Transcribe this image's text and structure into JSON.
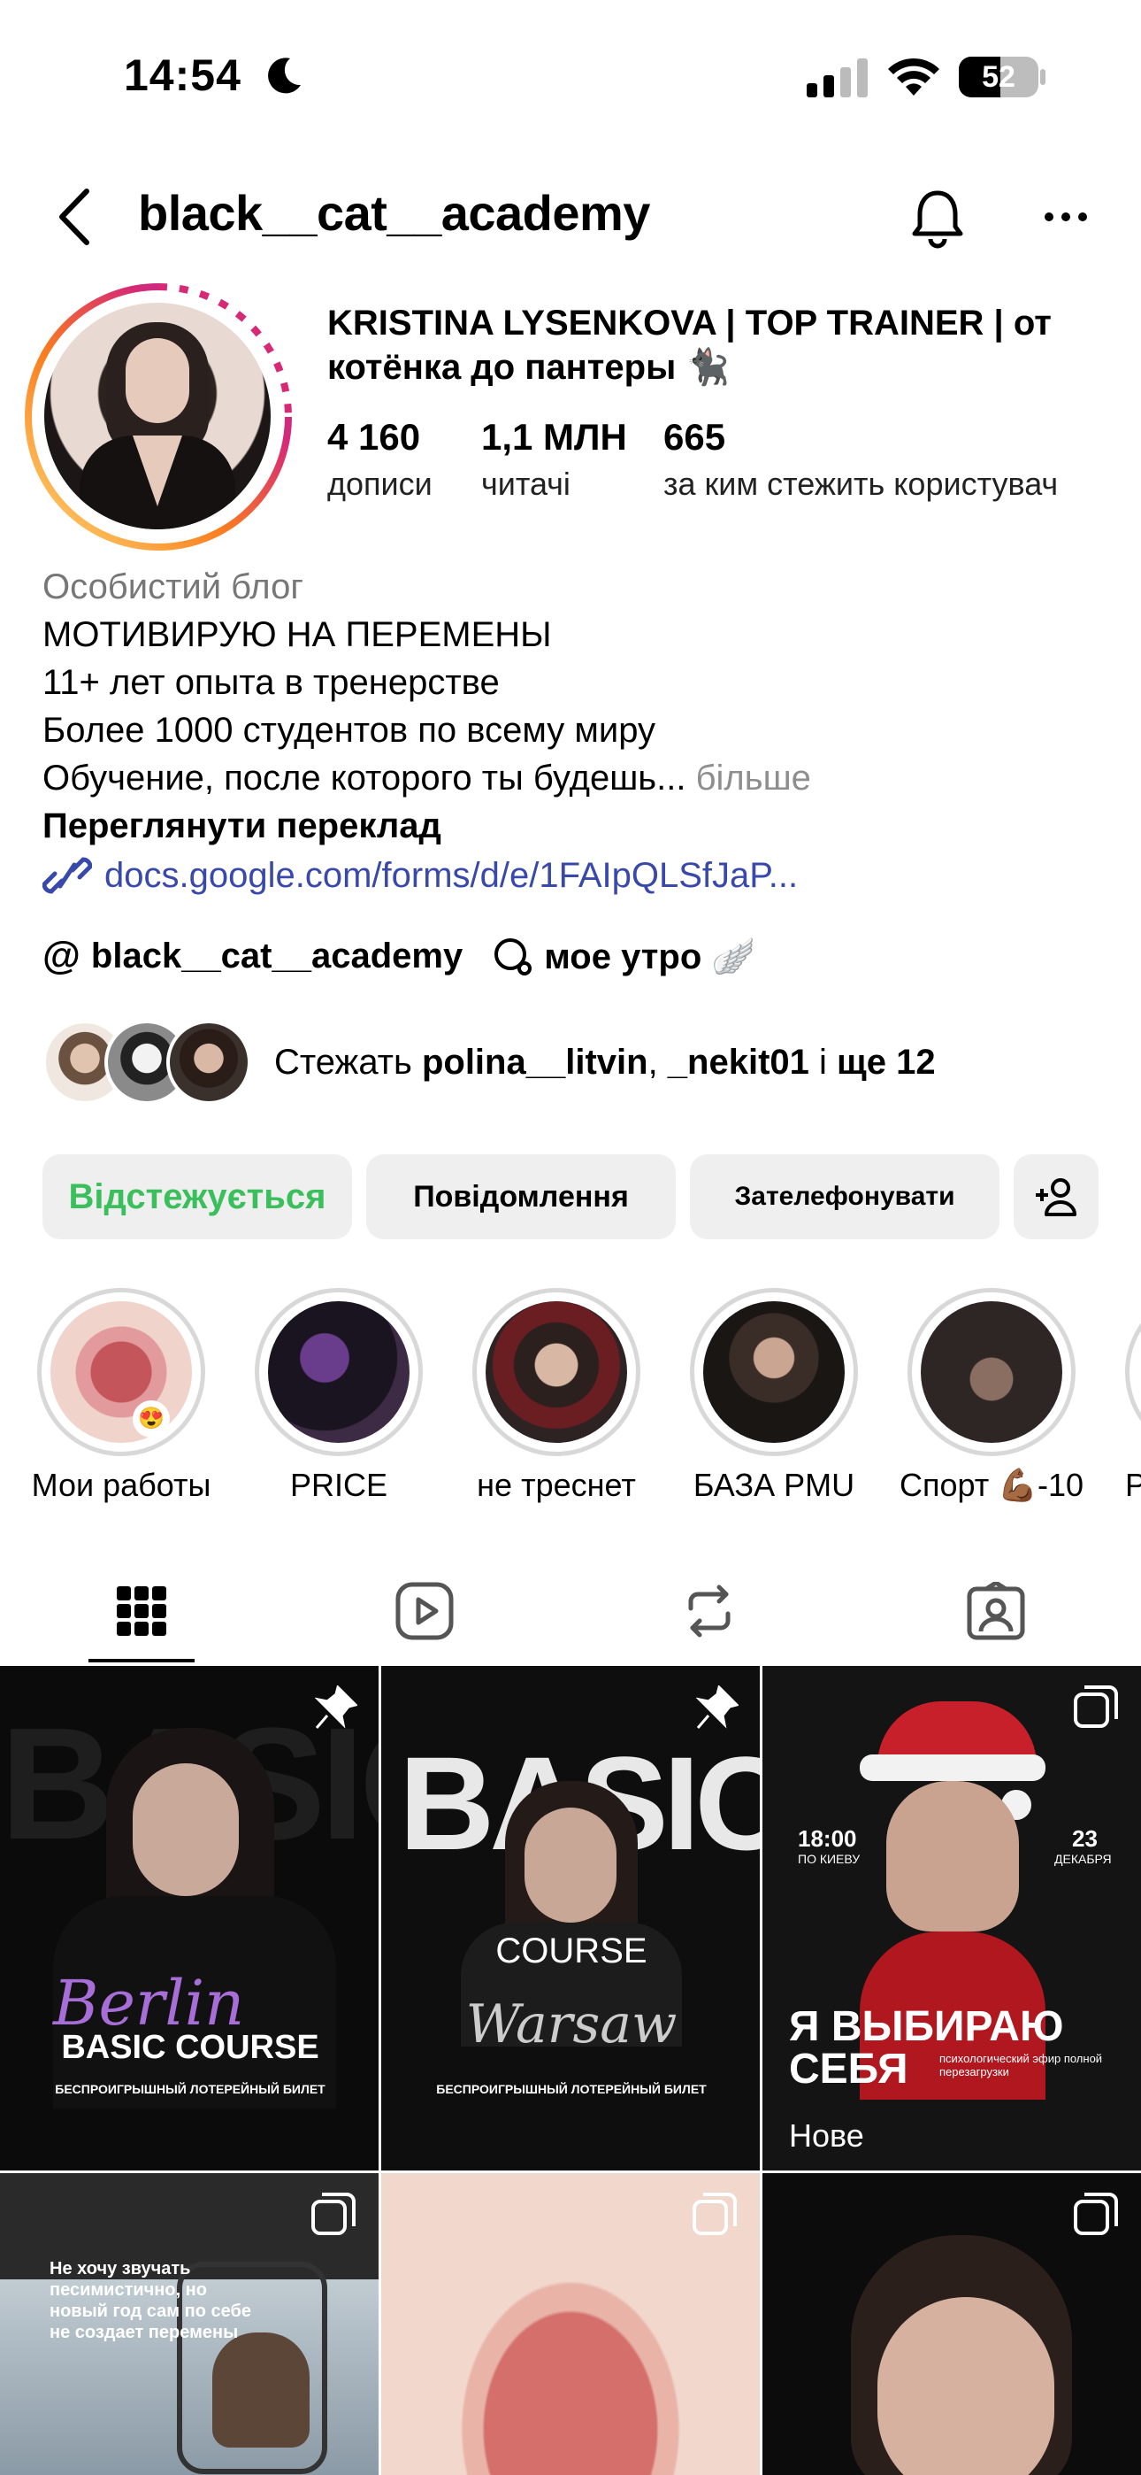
{
  "status_bar": {
    "time": "14:54",
    "battery": "52"
  },
  "header": {
    "username": "black__cat__academy"
  },
  "profile": {
    "display_name": "KRISTINA LYSENKOVA | TOP TRAINER | от котёнка до пантеры 🐈‍⬛",
    "stats": [
      {
        "value": "4 160",
        "label": "дописи"
      },
      {
        "value": "1,1 МЛН",
        "label": "читачі"
      },
      {
        "value": "665",
        "label": "за ким стежить користувач"
      }
    ],
    "category": "Особистий блог",
    "bio_lines": [
      "МОТИВИРУЮ НА ПЕРЕМЕНЫ",
      "11+ лет опыта в тренерстве",
      "Более 1000 студентов по всему миру",
      "Обучение, после которого ты будешь..."
    ],
    "more_label": "більше",
    "translate_label": "Переглянути переклад",
    "link": "docs.google.com/forms/d/e/1FAIpQLSfJaP...",
    "threads_handle": "black__cat__academy",
    "note": "мое утро 🪽"
  },
  "followed_by": {
    "prefix": "Стежать ",
    "names": "polina__litvin",
    "sep": ", ",
    "name2": "_nekit01",
    "mid": " і ",
    "suffix": "ще 12"
  },
  "actions": {
    "following": "Відстежується",
    "message": "Повідомлення",
    "call": "Зателефонувати"
  },
  "highlights": [
    {
      "label": "Мои работы"
    },
    {
      "label": "PRICE"
    },
    {
      "label": "не треснет"
    },
    {
      "label": "БАЗА PMU"
    },
    {
      "label": "Спорт 💪🏾-10"
    },
    {
      "label": "P"
    }
  ],
  "posts": [
    {
      "texts": [
        "Berlin",
        "BASIC COURSE",
        "БЕСПРОИГРЫШНЫЙ ЛОТЕРЕЙНЫЙ БИЛЕТ"
      ]
    },
    {
      "texts": [
        "BASIC",
        "COURSE",
        "Warsaw",
        "БЕСПРОИГРЫШНЫЙ ЛОТЕРЕЙНЫЙ БИЛЕТ"
      ]
    },
    {
      "texts": [
        "18:00",
        "ПО КИЕВУ",
        "23",
        "ДЕКАБРЯ",
        "Я ВЫБИРАЮ",
        "СЕБЯ",
        "психологический эфир полной перезагрузки",
        "Нове"
      ]
    },
    {
      "texts": [
        "Не хочу звучать песимистично, но новый год сам по себе не создает перемены"
      ]
    }
  ],
  "colors": {
    "following_green": "#3bbf5c",
    "link_blue": "#3949ab",
    "button_bg": "#efefef"
  }
}
